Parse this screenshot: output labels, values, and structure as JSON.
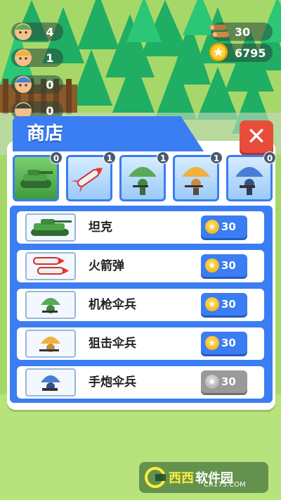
{
  "hud": {
    "troops": [
      {
        "icon": "green-soldier-icon",
        "value": "4"
      },
      {
        "icon": "orange-soldier-icon",
        "value": "1"
      },
      {
        "icon": "blue-soldier-icon",
        "value": "0"
      },
      {
        "icon": "dark-soldier-icon",
        "value": "0"
      }
    ],
    "wood": {
      "icon": "wood-log-icon",
      "value": "30"
    },
    "coins": {
      "icon": "coin-icon",
      "value": "6795"
    }
  },
  "shop": {
    "title": "商店",
    "close_label": "✕",
    "tabs": [
      {
        "name": "tank",
        "count": "0"
      },
      {
        "name": "rocket",
        "count": "1"
      },
      {
        "name": "machine-gun-paratrooper",
        "count": "1"
      },
      {
        "name": "sniper-paratrooper",
        "count": "1"
      },
      {
        "name": "bazooka-paratrooper",
        "count": "0"
      }
    ],
    "items": [
      {
        "name": "坦克",
        "price": "30",
        "enabled": true
      },
      {
        "name": "火箭弹",
        "price": "30",
        "enabled": true
      },
      {
        "name": "机枪伞兵",
        "price": "30",
        "enabled": true
      },
      {
        "name": "狙击伞兵",
        "price": "30",
        "enabled": true
      },
      {
        "name": "手炮伞兵",
        "price": "30",
        "enabled": false
      }
    ]
  },
  "watermark": {
    "brand": "西西",
    "label": "软件园",
    "sub": "CR173.COM"
  },
  "colors": {
    "accent": "#3b7df2",
    "close": "#e84d3c",
    "disabled": "#9a9a9a",
    "coin": "#f2a500"
  }
}
